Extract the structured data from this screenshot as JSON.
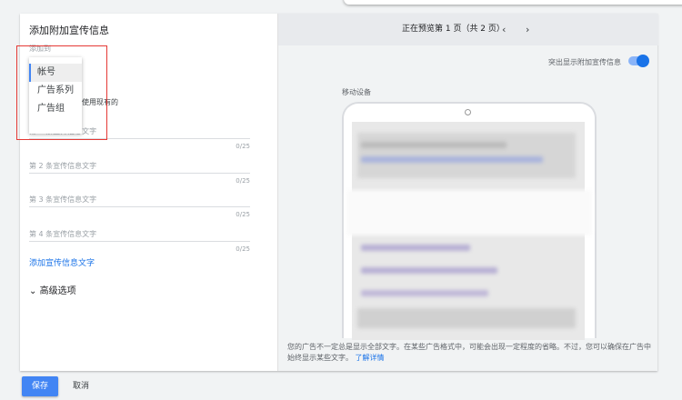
{
  "form": {
    "title": "添加附加宣传信息",
    "add_to_label": "添加到",
    "menu_items": [
      "帐号",
      "广告系列",
      "广告组"
    ],
    "use_existing": "使用现有的",
    "fields": [
      {
        "label": "第 1 条宣传信息文字",
        "counter": "0/25"
      },
      {
        "label": "第 2 条宣传信息文字",
        "counter": "0/25"
      },
      {
        "label": "第 3 条宣传信息文字",
        "counter": "0/25"
      },
      {
        "label": "第 4 条宣传信息文字",
        "counter": "0/25"
      }
    ],
    "add_link": "添加宣传信息文字",
    "advanced": "高级选项"
  },
  "preview": {
    "page_indicator": "正在预览第 1 页（共 2 页）",
    "prev": "‹",
    "next": "›",
    "highlight_label": "突出显示附加宣传信息",
    "highlight_on": true,
    "device_label": "移动设备",
    "note": "您的广告不一定总是显示全部文字。在某些广告格式中，可能会出现一定程度的省略。不过，您可以确保在广告中始终显示某些文字。",
    "learn_more": "了解详情"
  },
  "actions": {
    "save": "保存",
    "cancel": "取消"
  },
  "colors": {
    "accent": "#1a73e8",
    "highlight_box": "#e53935"
  }
}
